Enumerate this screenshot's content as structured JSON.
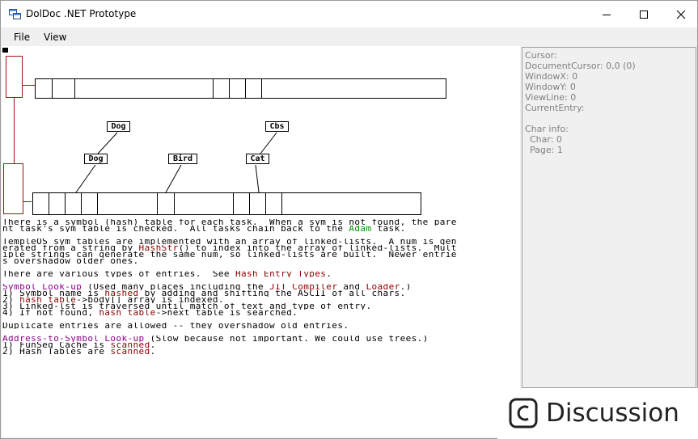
{
  "window": {
    "title": "DolDoc .NET Prototype"
  },
  "menu": {
    "items": [
      "File",
      "View"
    ]
  },
  "diagram": {
    "labels": {
      "dog_top": "Dog",
      "cbs": "Cbs",
      "dog": "Dog",
      "bird": "Bird",
      "cat": "Cat"
    }
  },
  "document": {
    "lines": [
      [
        {
          "t": "There is a symbol (hash) table for each task.  When a sym is not found, the pare"
        }
      ],
      [
        {
          "t": "nt task's sym table is checked.  All tasks chain back to the "
        },
        {
          "t": "Adam",
          "c": "grn"
        },
        {
          "t": " task."
        }
      ],
      [],
      [
        {
          "t": "TempleOS sym tables are implemented with an array of linked-lists.  A num is gen"
        }
      ],
      [
        {
          "t": "erated from a string by "
        },
        {
          "t": "HashStr",
          "c": "lnk"
        },
        {
          "t": "() to index into the array of linked-lists.  Mult"
        }
      ],
      [
        {
          "t": "iple strings can generate the same num, so linked-lists are built.  Newer entrie"
        }
      ],
      [
        {
          "t": "s overshadow older ones."
        }
      ],
      [],
      [
        {
          "t": "There are various types of entries.  See "
        },
        {
          "t": "Hash Entry Types",
          "c": "lnk"
        },
        {
          "t": "."
        }
      ],
      [],
      [
        {
          "t": "Symbol Look-up",
          "c": "pur"
        },
        {
          "t": " (Used many places including the "
        },
        {
          "t": "JIT Compiler",
          "c": "lnk"
        },
        {
          "t": " and "
        },
        {
          "t": "Loader",
          "c": "lnk"
        },
        {
          "t": ".)"
        }
      ],
      [
        {
          "t": "1) Symbol name is "
        },
        {
          "t": "hashed",
          "c": "lnk"
        },
        {
          "t": " by adding and shifting the ASCII of all chars."
        }
      ],
      [
        {
          "t": "2) "
        },
        {
          "t": "hash table",
          "c": "lnk"
        },
        {
          "t": "->body[] array is indexed."
        }
      ],
      [
        {
          "t": "3) Linked-lst is traversed until match of text and type of entry."
        }
      ],
      [
        {
          "t": "4) If not found, "
        },
        {
          "t": "hash table",
          "c": "lnk"
        },
        {
          "t": "->next table is searched."
        }
      ],
      [],
      [
        {
          "t": "Duplicate entries are allowed -- they overshadow old entries."
        }
      ],
      [],
      [
        {
          "t": "Address-to-Symbol Look-up",
          "c": "pur"
        },
        {
          "t": " (Slow because not important. We could use trees.)"
        }
      ],
      [
        {
          "t": "1) FunSeg Cache is "
        },
        {
          "t": "scanned",
          "c": "lnk"
        },
        {
          "t": "."
        }
      ],
      [
        {
          "t": "2) Hash Tables are "
        },
        {
          "t": "scanned",
          "c": "lnk"
        },
        {
          "t": "."
        }
      ]
    ]
  },
  "info_panel": {
    "cursor": "Cursor:",
    "document_cursor": "DocumentCursor: 0,0 (0)",
    "window_x": "WindowX: 0",
    "window_y": "WindowY: 0",
    "view_line": "ViewLine: 0",
    "current_entry": "CurrentEntry:",
    "char_info": "Char info:",
    "char": "Char: 0",
    "page": "Page: 1"
  },
  "watermark": {
    "text": "Discussion"
  },
  "colors": {
    "link": "#8b0000",
    "green": "#009000",
    "purple": "#8a008a",
    "diagram_red": "#a01010"
  }
}
